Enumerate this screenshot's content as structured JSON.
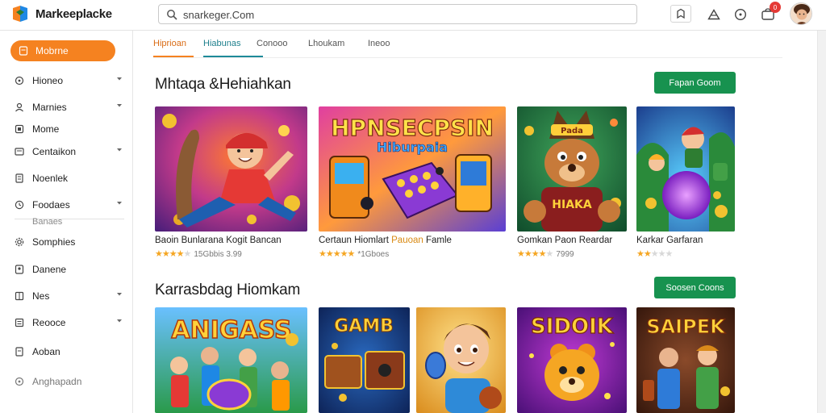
{
  "header": {
    "brand": "Markeeplacke",
    "search_value": "snarkeger.Com",
    "notification_count": "0"
  },
  "sidebar": {
    "primary": "Mobrne",
    "items": [
      {
        "label": "Hioneo",
        "icon": "circle-icon",
        "chevron": true
      },
      {
        "label": "Marnies",
        "icon": "user-icon",
        "chevron": true
      },
      {
        "label": "Mome",
        "icon": "square-icon",
        "chevron": false
      },
      {
        "label": "Centaikon",
        "icon": "card-icon",
        "chevron": true
      },
      {
        "label": "Noenlek",
        "icon": "doc-icon",
        "chevron": false
      },
      {
        "label": "Foodaes",
        "icon": "clock-icon",
        "chevron": true
      },
      {
        "label": "Somphies",
        "icon": "gear-icon",
        "chevron": false
      },
      {
        "label": "Danene",
        "icon": "user-icon",
        "chevron": false
      },
      {
        "label": "Nes",
        "icon": "grid-icon",
        "chevron": true
      },
      {
        "label": "Reooce",
        "icon": "list-icon",
        "chevron": true
      },
      {
        "label": "Aoban",
        "icon": "doc-icon",
        "chevron": false
      },
      {
        "label": "Anghapadn",
        "icon": "circle-icon",
        "chevron": false
      }
    ],
    "sub_label": "Banaes"
  },
  "tabs": [
    "Hiprioan",
    "Hiabunas",
    "Conooo",
    "Lhoukam",
    "Ineoo"
  ],
  "sections": [
    {
      "title": "Mhtaqa &Hehiahkan",
      "button": "Fapan Goom",
      "cards": [
        {
          "title": "Baoin Bunlarana Kogit Bancan",
          "title_hl": "",
          "title_end": "",
          "stars": 4,
          "meta": "15Gbbis 3.99"
        },
        {
          "title": "Certaun Hiomlart ",
          "title_hl": "Pauoan",
          "title_end": " Famle",
          "stars": 5,
          "meta": "*1Gboes"
        },
        {
          "title": "Gomkan Paon Reardar",
          "title_hl": "",
          "title_end": "",
          "stars": 4,
          "meta": "7999"
        },
        {
          "title": "Karkar Garfaran",
          "title_hl": "",
          "title_end": "",
          "stars": 2,
          "meta": ""
        }
      ]
    },
    {
      "title": "Karrasbdag Hiomkam",
      "button": "Soosen Coons",
      "cards": [
        {
          "art_text": "ANIGASS"
        },
        {
          "art_text": "GAMB"
        },
        {
          "art_text": ""
        },
        {
          "art_text": "SIDOIK"
        },
        {
          "art_text": "SAIPEK"
        }
      ]
    }
  ],
  "card_art": {
    "c1_banner": "",
    "c2_banner_top": "HPNSECPSIN",
    "c2_banner_sub": "Hiburpaia",
    "c3_banner": "HIAKA",
    "c3_sign": "Pada"
  },
  "colors": {
    "accent": "#f58220",
    "button_green": "#17924f",
    "tab_teal": "#1d8a99",
    "star": "#f5a623"
  }
}
